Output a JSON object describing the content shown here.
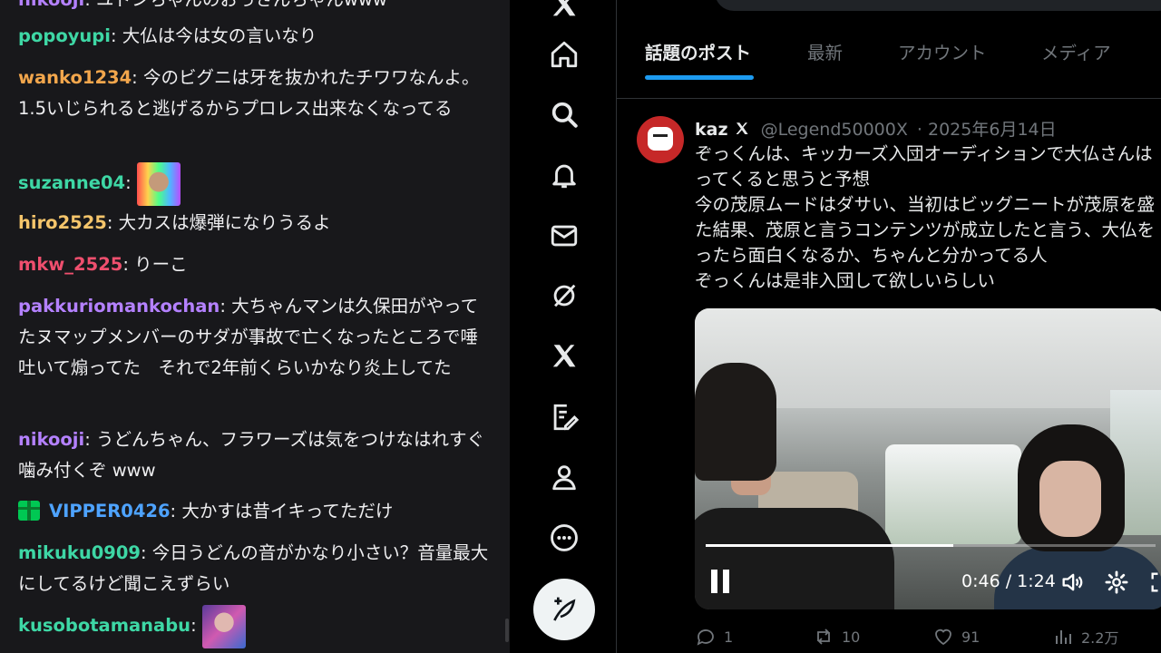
{
  "chat": {
    "messages": [
      {
        "user": "nikooji",
        "sep": ": ",
        "text": "ユドンちゃんのおっさんちゃんwww",
        "color": "#b481ff"
      },
      {
        "user": "popoyupi",
        "sep": ": ",
        "text": "大仏は今は女の言いなり",
        "color": "#3ed7a5"
      },
      {
        "user": "wanko1234",
        "sep": ": ",
        "text": "今のビグニは牙を抜かれたチワワなんよ。1.5いじられると逃げるからプロレス出来なくなってる",
        "color": "#f2a64c"
      },
      {
        "user": "suzanne04",
        "sep": ": ",
        "text": "",
        "color": "#3ed7a5"
      },
      {
        "user": "hiro2525",
        "sep": ": ",
        "text": "大カスは爆弾になりうるよ",
        "color": "#f5c56b"
      },
      {
        "user": "mkw_2525",
        "sep": ": ",
        "text": "りーこ",
        "color": "#ef4f6e"
      },
      {
        "user": "pakkuriomankochan",
        "sep": ": ",
        "text": "大ちゃんマンは久保田がやってたヌマップメンバーのサダが事故で亡くなったところで唾吐いて煽ってた　それで2年前くらいかなり炎上してた",
        "color": "#b481ff"
      },
      {
        "user": "nikooji",
        "sep": ": ",
        "text": "うどんちゃん、フラワーズは気をつけなはれすぐ噛み付くぞ www",
        "color": "#b481ff"
      },
      {
        "user": "VIPPER0426",
        "sep": ": ",
        "text": "大かすは昔イキってただけ",
        "color": "#4ea3ff"
      },
      {
        "user": "mikuku0909",
        "sep": ": ",
        "text": "今日うどんの音がかなり小さい？音量最大にしてるけど聞こえずらい",
        "color": "#3ed7a5"
      },
      {
        "user": "kusobotamanabu",
        "sep": ": ",
        "text": "",
        "color": "#3ed7a5"
      }
    ]
  },
  "x": {
    "tabs": [
      "話題のポスト",
      "最新",
      "アカウント",
      "メディア"
    ],
    "post": {
      "name": "kaz",
      "handle": "@Legend50000X",
      "date": "· 2025年6月14日",
      "lines": [
        "ぞっくんは、キッカーズ入団オーディションで大仏さんは",
        "ってくると思うと予想",
        "今の茂原ムードはダサい、当初はビッグニートが茂原を盛",
        "た結果、茂原と言うコンテンツが成立したと言う、大仏を",
        "ったら面白くなるか、ちゃんと分かってる人",
        "ぞっくんは是非入団して欲しいらしい"
      ],
      "video": {
        "time": "0:46 / 1:24",
        "progress": 0.55
      },
      "actions": {
        "replies": "1",
        "reposts": "10",
        "likes": "91",
        "views": "2.2万"
      }
    }
  }
}
